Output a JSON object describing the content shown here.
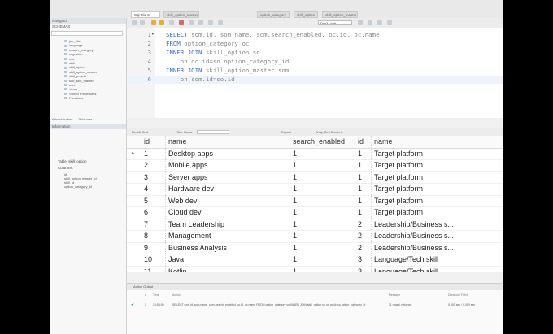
{
  "tabs": [
    {
      "label": "Sql File 6*",
      "active": true
    },
    {
      "label": "skill_option_master",
      "active": false
    },
    {
      "label": "option_category",
      "active": false
    },
    {
      "label": "skill_option",
      "active": false
    },
    {
      "label": "skill_option_master",
      "active": false
    }
  ],
  "sidebar": {
    "header": "Navigator",
    "schemas_label": "SCHEMAS",
    "tree": [
      "job_title",
      "language",
      "master_category",
      "migration",
      "role",
      "skill",
      "skill_option",
      "skill_option_master",
      "skill_project",
      "sub_skill_master",
      "user",
      "views",
      "Stored Procedures",
      "Functions"
    ],
    "tabs": [
      "Administration",
      "Schemas"
    ],
    "info_header": "Information",
    "info_title": "Table: skill_option",
    "columns_label": "Columns:",
    "columns": [
      "id",
      "skill_option_master_id",
      "skill_id",
      "option_category_id"
    ]
  },
  "toolbar": {
    "limit_label": "Don't Limit"
  },
  "editor": {
    "lines": [
      {
        "n": "1",
        "dot": "•",
        "parts": [
          {
            "t": "SELECT",
            "k": true
          },
          {
            "t": " som.id, som.name, som.search_enabled, oc.id, oc.name",
            "k": false
          }
        ]
      },
      {
        "n": "2",
        "dot": "",
        "parts": [
          {
            "t": "FROM",
            "k": true
          },
          {
            "t": " option_category oc",
            "k": false
          }
        ]
      },
      {
        "n": "3",
        "dot": "",
        "parts": [
          {
            "t": "INNER JOIN",
            "k": true
          },
          {
            "t": " skill_option so",
            "k": false
          }
        ]
      },
      {
        "n": "4",
        "dot": "",
        "parts": [
          {
            "t": "    on oc.id=so.option_category_id",
            "k": false
          }
        ]
      },
      {
        "n": "5",
        "dot": "",
        "parts": [
          {
            "t": "INNER JOIN",
            "k": true
          },
          {
            "t": " skill_option_master som",
            "k": false
          }
        ]
      },
      {
        "n": "6",
        "dot": "",
        "parts": [
          {
            "t": "    on som.id=so.id",
            "k": false
          }
        ]
      }
    ]
  },
  "results": {
    "toolbar": {
      "result_grid": "Result Grid",
      "filter_rows": "Filter Rows:",
      "export": "Export:",
      "wrap": "Wrap Cell Content:"
    },
    "columns": [
      "id",
      "name",
      "search_enabled",
      "id",
      "name"
    ],
    "rows": [
      [
        "1",
        "Desktop apps",
        "1",
        "1",
        "Target platform"
      ],
      [
        "2",
        "Mobile apps",
        "1",
        "1",
        "Target platform"
      ],
      [
        "3",
        "Server apps",
        "1",
        "1",
        "Target platform"
      ],
      [
        "4",
        "Hardware dev",
        "1",
        "1",
        "Target platform"
      ],
      [
        "5",
        "Web dev",
        "1",
        "1",
        "Target platform"
      ],
      [
        "6",
        "Cloud dev",
        "1",
        "1",
        "Target platform"
      ],
      [
        "7",
        "Team Leadership",
        "1",
        "2",
        "Leadership/Business s..."
      ],
      [
        "8",
        "Management",
        "1",
        "2",
        "Leadership/Business s..."
      ],
      [
        "9",
        "Business Analysis",
        "1",
        "2",
        "Leadership/Business s..."
      ],
      [
        "10",
        "Java",
        "1",
        "3",
        "Language/Tech skill"
      ],
      [
        "11",
        "Kotlin",
        "1",
        "3",
        "Language/Tech skill"
      ]
    ]
  },
  "output": {
    "tab": "Action Output",
    "headers": [
      "#",
      "Time",
      "Action",
      "Message",
      "Duration / Fetch"
    ],
    "line": {
      "n": "1",
      "time": "10:53:09",
      "action": "SELECT som.id, som.name, som.search_enabled, oc.id, oc.name FROM option_category oc INNER JOIN skill_option so on oc.id=so.option_category_id",
      "message": "11 row(s) returned",
      "duration": "0.000 sec / 0.000 sec"
    }
  }
}
